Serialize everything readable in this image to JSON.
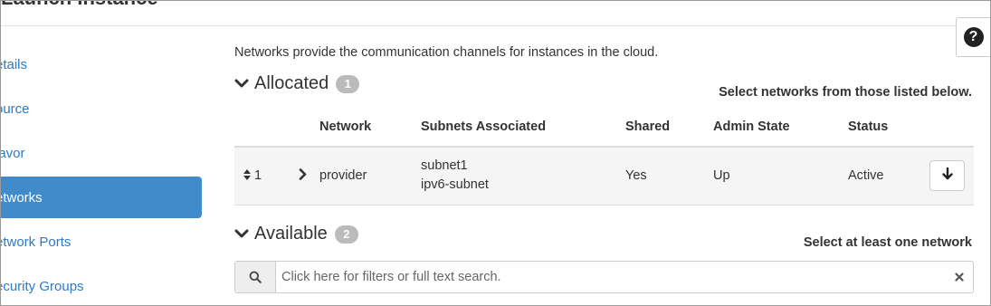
{
  "dialog": {
    "title": "Launch Instance"
  },
  "help": {
    "icon": "question-circle-icon",
    "glyph": "?"
  },
  "sidebar": {
    "items": [
      {
        "label": "etails",
        "active": false
      },
      {
        "label": "ource",
        "active": false
      },
      {
        "label": "lavor",
        "active": false
      },
      {
        "label": "etworks",
        "active": true
      },
      {
        "label": "etwork Ports",
        "active": false
      },
      {
        "label": "ecurity Groups",
        "active": false
      }
    ]
  },
  "main": {
    "intro": "Networks provide the communication channels for instances in the cloud.",
    "allocated": {
      "title": "Allocated",
      "count": "1",
      "hint": "Select networks from those listed below.",
      "columns": [
        "Network",
        "Subnets Associated",
        "Shared",
        "Admin State",
        "Status"
      ],
      "rows": [
        {
          "order": "1",
          "network": "provider",
          "subnets": [
            "subnet1",
            "ipv6-subnet"
          ],
          "shared": "Yes",
          "admin_state": "Up",
          "status": "Active"
        }
      ]
    },
    "available": {
      "title": "Available",
      "count": "2",
      "hint": "Select at least one network",
      "search_placeholder": "Click here for filters or full text search."
    }
  },
  "colors": {
    "accent": "#428bca",
    "link": "#2b7bc4",
    "badge": "#bbbbbb",
    "row_bg": "#f5f5f5"
  }
}
